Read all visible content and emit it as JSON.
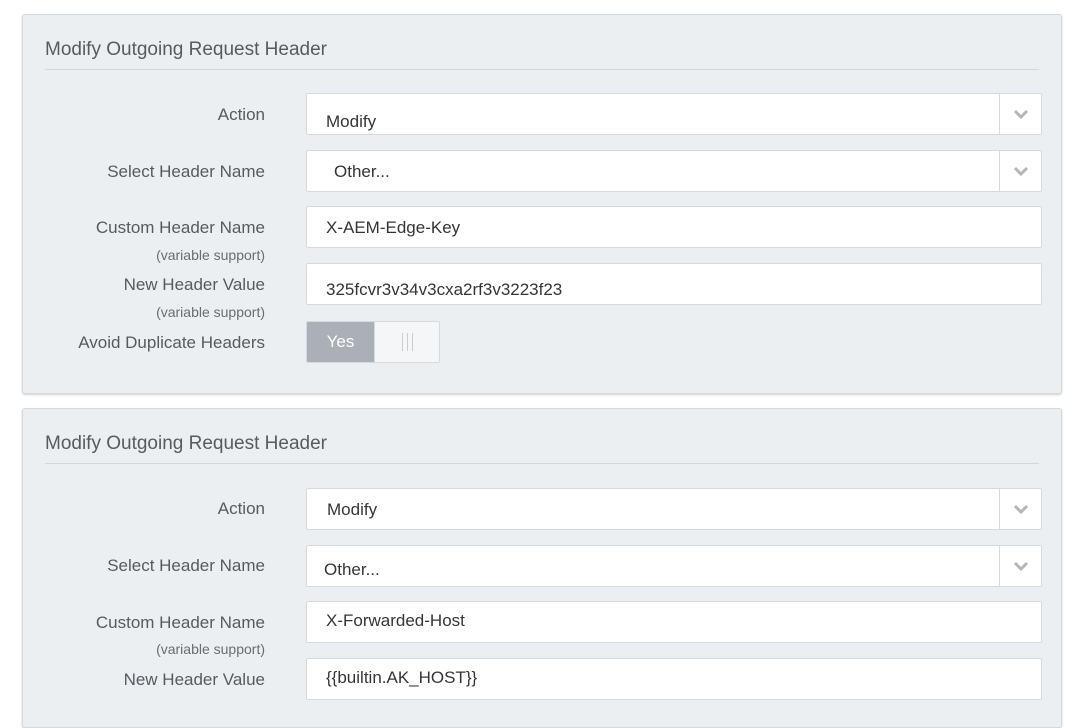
{
  "panels": [
    {
      "title": "Modify Outgoing Request Header",
      "action_label": "Action",
      "action_value": "Modify",
      "header_name_label": "Select Header Name",
      "header_name_value": "Other...",
      "custom_name_label": "Custom Header Name",
      "custom_name_sublabel": "(variable support)",
      "custom_name_value": "X-AEM-Edge-Key",
      "new_value_label": "New Header Value",
      "new_value_sublabel": "(variable support)",
      "new_value_value": "325fcvr3v34v3cxa2rf3v3223f23",
      "avoid_dup_label": "Avoid Duplicate Headers",
      "avoid_dup_toggle": "Yes"
    },
    {
      "title": "Modify Outgoing Request Header",
      "action_label": "Action",
      "action_value": "Modify",
      "header_name_label": "Select Header Name",
      "header_name_value": "Other...",
      "custom_name_label": "Custom Header Name",
      "custom_name_sublabel": "(variable support)",
      "custom_name_value": "X-Forwarded-Host",
      "new_value_label": "New Header Value",
      "new_value_value": "{{builtin.AK_HOST}}"
    }
  ],
  "icons": {
    "select_arrow": "chevron-down-icon",
    "toggle_handle": "grip-icon"
  },
  "colors": {
    "panel_bg": "#eceff1",
    "toggle_on": "#aab0b6",
    "label_text": "#555b61"
  }
}
